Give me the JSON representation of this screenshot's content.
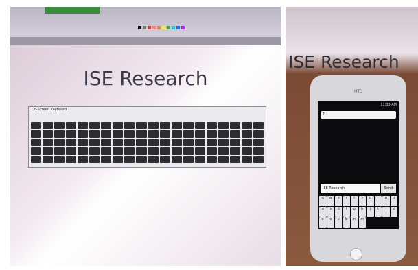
{
  "left_photo": {
    "screen_title": "ISE Research",
    "keyboard_window_title": "On-Screen Keyboard"
  },
  "right_photo": {
    "screen_title": "ISE Research",
    "phone": {
      "brand": "HTC",
      "status_time": "11:33 AM",
      "search_text": "Ti",
      "message_text": "ISE Research",
      "send_label": "Send",
      "keyboard_rows": [
        [
          "q",
          "w",
          "e",
          "r",
          "t",
          "y",
          "u",
          "i",
          "o",
          "p"
        ],
        [
          "a",
          "s",
          "d",
          "f",
          "g",
          "h",
          "j",
          "k",
          "l"
        ],
        [
          "z",
          "x",
          "c",
          "v",
          "b",
          "n",
          "m"
        ]
      ]
    }
  }
}
